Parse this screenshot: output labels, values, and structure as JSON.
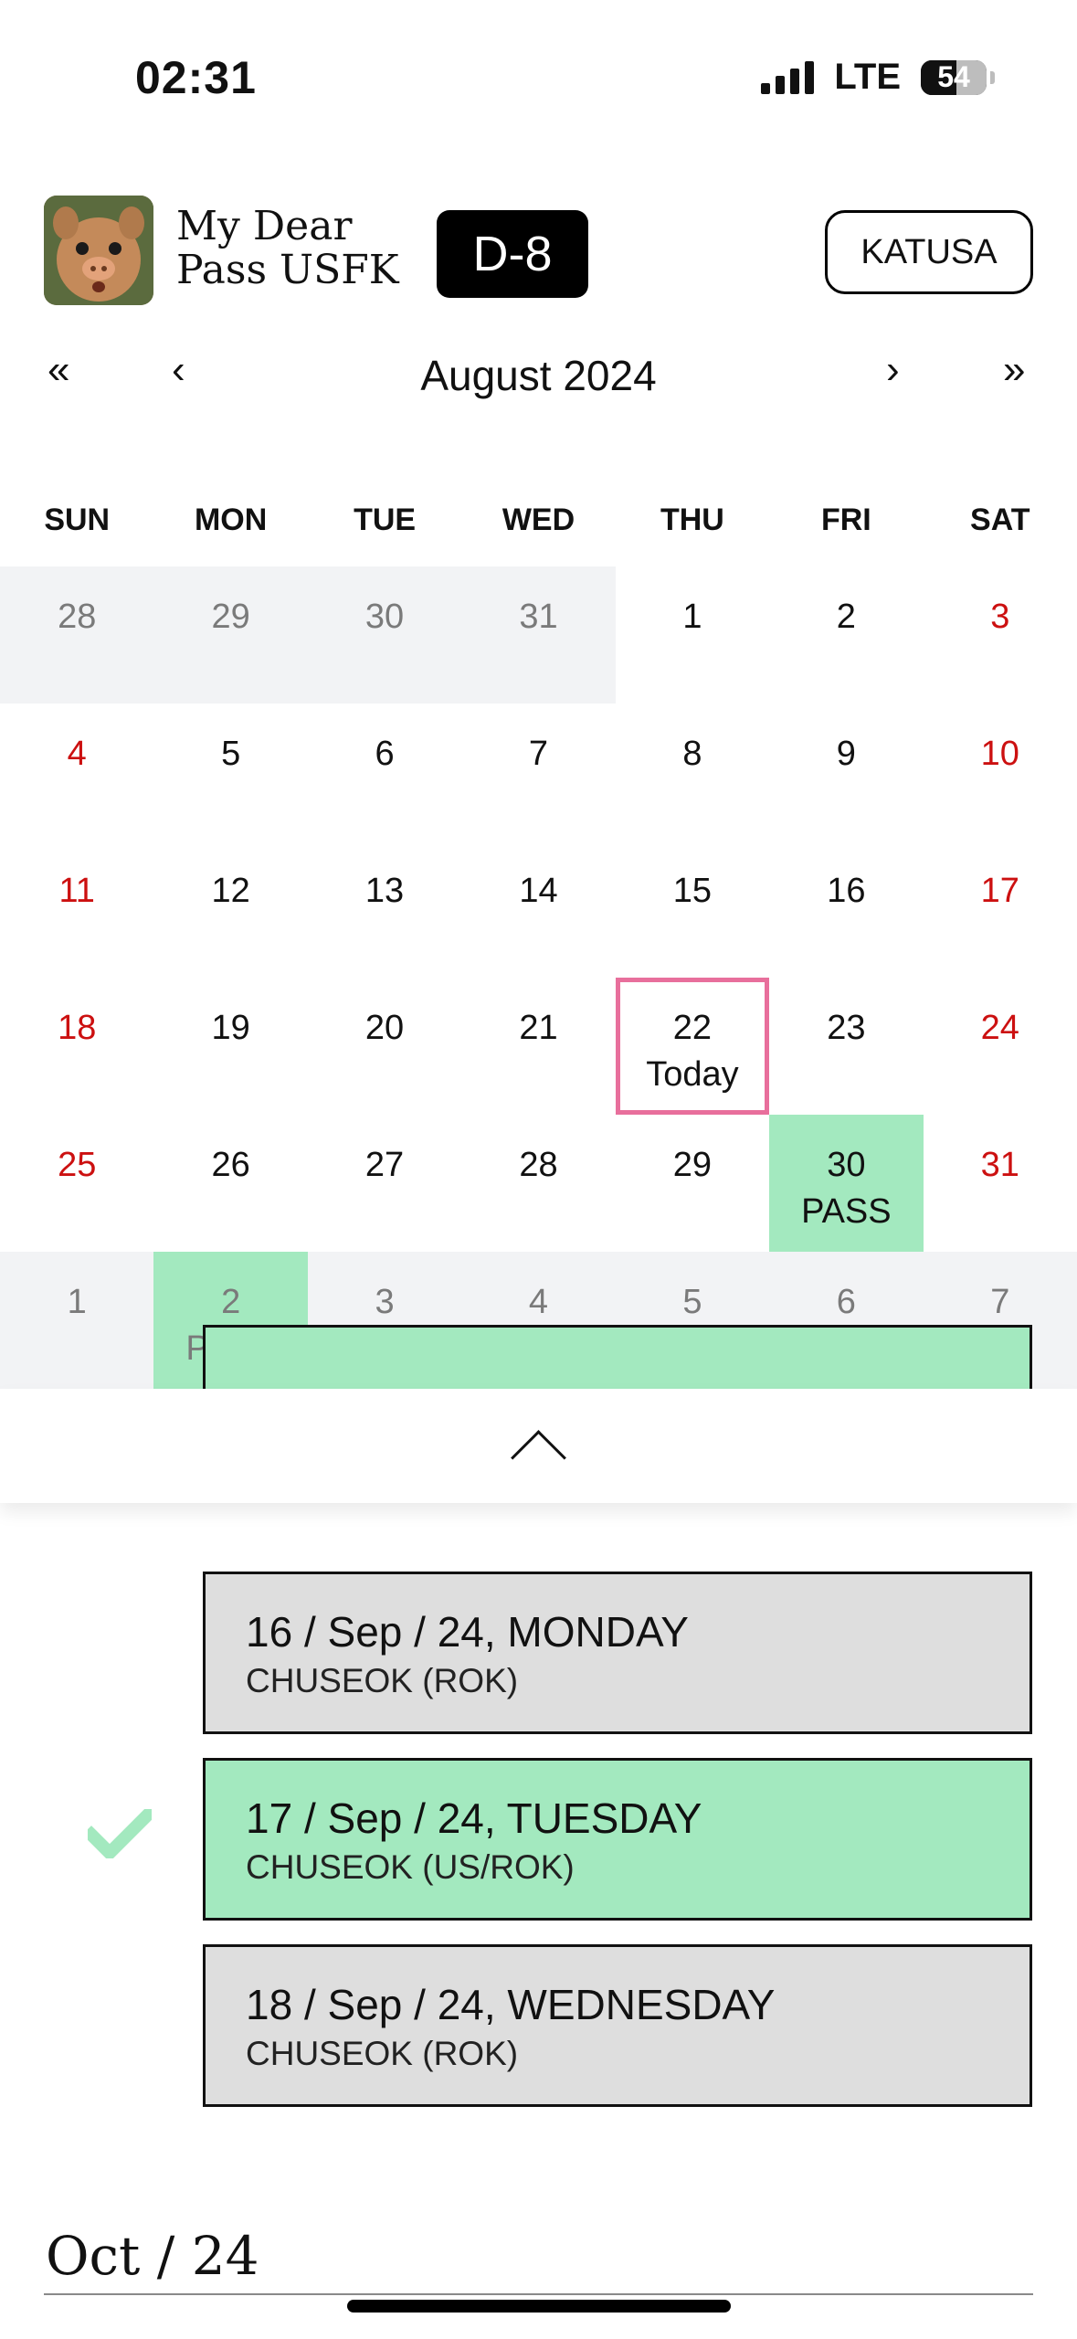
{
  "status_bar": {
    "time": "02:31",
    "network": "LTE",
    "battery": "54",
    "battery_level": 0.54
  },
  "header": {
    "title_line1": "My Dear",
    "title_line2": "Pass USFK",
    "dday": "D-8",
    "katusa_button": "KATUSA",
    "avatar_icon": "pig-avatar-icon"
  },
  "calendar": {
    "month_label": "August 2024",
    "nav": {
      "prev_year": "«",
      "prev_month": "‹",
      "next_month": "›",
      "next_year": "»"
    },
    "weekdays": [
      "SUN",
      "MON",
      "TUE",
      "WED",
      "THU",
      "FRI",
      "SAT"
    ],
    "weeks": [
      [
        {
          "d": "28",
          "o": true
        },
        {
          "d": "29",
          "o": true
        },
        {
          "d": "30",
          "o": true
        },
        {
          "d": "31",
          "o": true
        },
        {
          "d": "1"
        },
        {
          "d": "2"
        },
        {
          "d": "3",
          "w": true
        }
      ],
      [
        {
          "d": "4",
          "w": true
        },
        {
          "d": "5"
        },
        {
          "d": "6"
        },
        {
          "d": "7"
        },
        {
          "d": "8"
        },
        {
          "d": "9"
        },
        {
          "d": "10",
          "w": true
        }
      ],
      [
        {
          "d": "11",
          "w": true
        },
        {
          "d": "12"
        },
        {
          "d": "13"
        },
        {
          "d": "14"
        },
        {
          "d": "15"
        },
        {
          "d": "16"
        },
        {
          "d": "17",
          "w": true
        }
      ],
      [
        {
          "d": "18",
          "w": true
        },
        {
          "d": "19"
        },
        {
          "d": "20"
        },
        {
          "d": "21"
        },
        {
          "d": "22",
          "sub": "Today",
          "today": true
        },
        {
          "d": "23"
        },
        {
          "d": "24",
          "w": true
        }
      ],
      [
        {
          "d": "25",
          "w": true
        },
        {
          "d": "26"
        },
        {
          "d": "27"
        },
        {
          "d": "28"
        },
        {
          "d": "29"
        },
        {
          "d": "30",
          "sub": "PASS",
          "pass": true
        },
        {
          "d": "31",
          "w": true
        }
      ],
      [
        {
          "d": "1",
          "o": true
        },
        {
          "d": "2",
          "o": true,
          "sub": "PASS",
          "pass": true
        },
        {
          "d": "3",
          "o": true
        },
        {
          "d": "4",
          "o": true
        },
        {
          "d": "5",
          "o": true
        },
        {
          "d": "6",
          "o": true
        },
        {
          "d": "7",
          "o": true
        }
      ]
    ],
    "collapse_icon": "chevron-up-icon"
  },
  "events": [
    {
      "date": "16 / Sep / 24, MONDAY",
      "name": "CHUSEOK (ROK)",
      "style": "gray",
      "checked": false
    },
    {
      "date": "17 / Sep / 24, TUESDAY",
      "name": "CHUSEOK (US/ROK)",
      "style": "green",
      "checked": true
    },
    {
      "date": "18 / Sep / 24, WEDNESDAY",
      "name": "CHUSEOK (ROK)",
      "style": "gray",
      "checked": false
    }
  ],
  "next_section": {
    "title": "Oct / 24"
  },
  "colors": {
    "pass_green": "#a3e9bf",
    "weekend_red": "#cc1010",
    "today_pink": "#e86f9c",
    "other_month_bg": "#f2f3f5",
    "event_gray": "#dedede"
  }
}
